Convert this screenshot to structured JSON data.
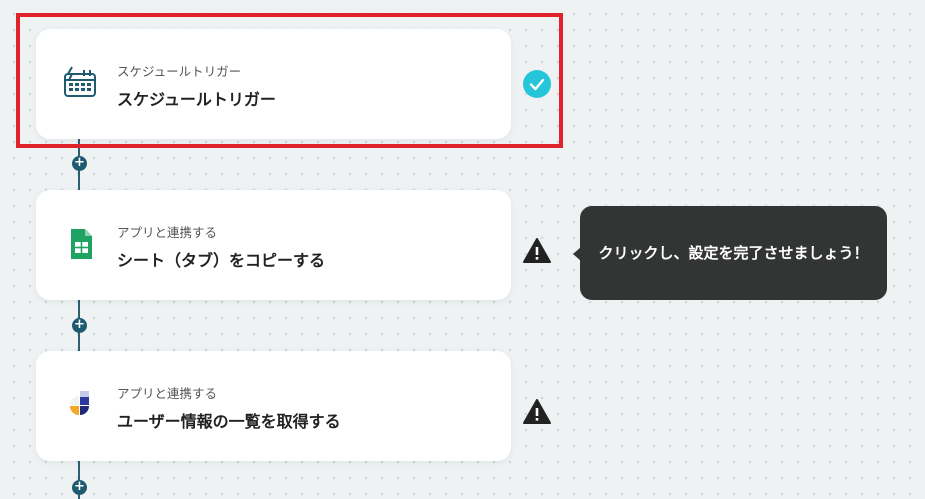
{
  "flow": {
    "steps": [
      {
        "subtitle": "スケジュールトリガー",
        "title": "スケジュールトリガー",
        "icon": "calendar-clock-icon",
        "status": "check-icon"
      },
      {
        "subtitle": "アプリと連携する",
        "title": "シート（タブ）をコピーする",
        "icon": "google-sheets-icon",
        "status": "warning-icon"
      },
      {
        "subtitle": "アプリと連携する",
        "title": "ユーザー情報の一覧を取得する",
        "icon": "app-logo-icon",
        "status": "warning-icon"
      }
    ],
    "add_step_symbol": "+"
  },
  "tooltip": {
    "text": "クリックし、設定を完了させましょう！"
  },
  "colors": {
    "accent": "#1e5a70",
    "check": "#26c6da",
    "highlight": "#e0232b",
    "tooltip_bg": "#333534"
  }
}
